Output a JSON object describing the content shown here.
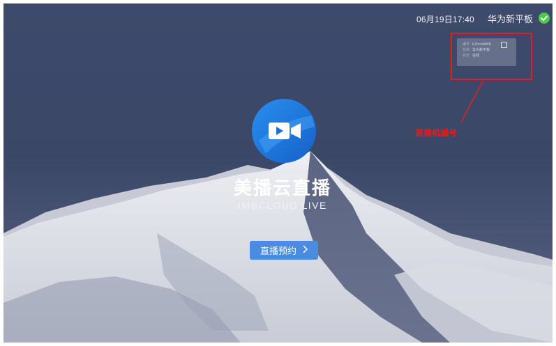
{
  "status_bar": {
    "datetime": "06月19日17:40",
    "device_name": "华为新平板",
    "status_icon": "check-circle-icon",
    "status_color": "#4fc94b"
  },
  "info_card": {
    "rows": [
      {
        "label": "编号",
        "value": "k2rxx4d08"
      },
      {
        "label": "名称",
        "value": "华为新平板"
      },
      {
        "label": "状态",
        "value": "在线"
      }
    ],
    "copy_icon": "copy-icon"
  },
  "annotation": {
    "label": "直播机编号",
    "color": "#e02020"
  },
  "app": {
    "logo_icon": "video-camera-icon",
    "title": "美播云直播",
    "subtitle": "IMBCLOUD LIVE"
  },
  "actions": {
    "reserve_label": "直播预约",
    "reserve_icon": "chevron-right-icon",
    "button_color": "#4a8de0"
  }
}
